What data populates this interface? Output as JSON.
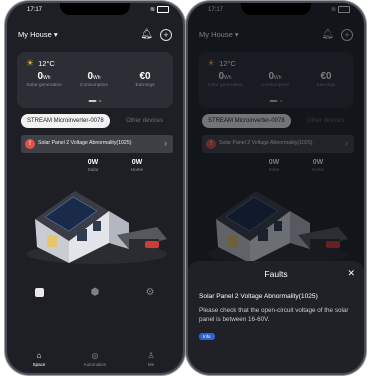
{
  "status": {
    "time": "17:17"
  },
  "header": {
    "house_label": "My House"
  },
  "weather": {
    "temperature": "12°C"
  },
  "metrics": [
    {
      "value": "0",
      "unit": "Wh",
      "label": "Solar generation"
    },
    {
      "value": "0",
      "unit": "Wh",
      "label": "Consumption"
    },
    {
      "value": "€0",
      "unit": "",
      "label": "Earnings"
    }
  ],
  "devices": {
    "active": "STREAM Microinverter-0078",
    "other": "Other devices"
  },
  "alert": {
    "text": "Solar Panel 2 Voltage Abnormality(1025)"
  },
  "power": [
    {
      "value": "0W",
      "label": "Solar"
    },
    {
      "value": "0W",
      "label": "Home"
    }
  ],
  "tabs": [
    {
      "label": "Space",
      "icon": "home-icon",
      "active": true
    },
    {
      "label": "Automation",
      "icon": "automation-icon",
      "active": false
    },
    {
      "label": "Me",
      "icon": "user-icon",
      "active": false
    }
  ],
  "faults": {
    "title": "Faults",
    "fault_name": "Solar Panel 2 Voltage Abnormality(1025)",
    "description": "Please check that the open-circuit voltage of the solar panel is between 16-60V.",
    "badge": "Info"
  },
  "colors": {
    "accent": "#2a63d6",
    "alert": "#e05149",
    "sun": "#f3b53a",
    "background": "#1d1f24"
  }
}
